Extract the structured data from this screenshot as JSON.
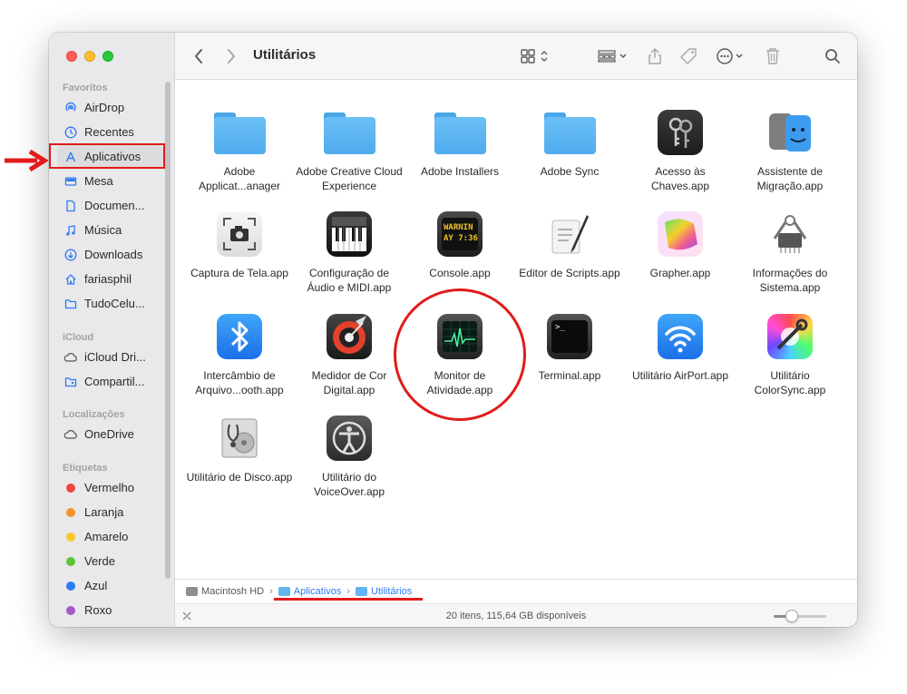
{
  "sidebar": {
    "sections": {
      "favoritos": "Favoritos",
      "icloud": "iCloud",
      "localizacoes": "Localizações",
      "etiquetas": "Etiquetas"
    },
    "favorites": [
      {
        "label": "AirDrop",
        "icon": "airdrop-icon"
      },
      {
        "label": "Recentes",
        "icon": "clock-icon"
      },
      {
        "label": "Aplicativos",
        "icon": "applications-icon"
      },
      {
        "label": "Mesa",
        "icon": "desktop-icon"
      },
      {
        "label": "Documen...",
        "icon": "document-icon"
      },
      {
        "label": "Música",
        "icon": "music-icon"
      },
      {
        "label": "Downloads",
        "icon": "download-icon"
      },
      {
        "label": "fariasphil",
        "icon": "home-icon"
      },
      {
        "label": "TudoCelu...",
        "icon": "folder-icon"
      }
    ],
    "icloud": [
      {
        "label": "iCloud Dri...",
        "icon": "cloud-icon"
      },
      {
        "label": "Compartil...",
        "icon": "shared-folder-icon"
      }
    ],
    "locations": [
      {
        "label": "OneDrive",
        "icon": "cloud-icon"
      }
    ],
    "tags": [
      {
        "label": "Vermelho",
        "color": "#f0463c"
      },
      {
        "label": "Laranja",
        "color": "#f5922e"
      },
      {
        "label": "Amarelo",
        "color": "#f5c92a"
      },
      {
        "label": "Verde",
        "color": "#5ec43a"
      },
      {
        "label": "Azul",
        "color": "#2f7bf5"
      },
      {
        "label": "Roxo",
        "color": "#a559c9"
      }
    ]
  },
  "toolbar": {
    "title": "Utilitários"
  },
  "items": [
    {
      "label": "Adobe Applicat...anager",
      "kind": "folder"
    },
    {
      "label": "Adobe Creative Cloud Experience",
      "kind": "folder"
    },
    {
      "label": "Adobe Installers",
      "kind": "folder"
    },
    {
      "label": "Adobe Sync",
      "kind": "folder"
    },
    {
      "label": "Acesso às Chaves.app",
      "kind": "keychain"
    },
    {
      "label": "Assistente de Migração.app",
      "kind": "migration"
    },
    {
      "label": "Captura de Tela.app",
      "kind": "screenshot"
    },
    {
      "label": "Configuração de Áudio e MIDI.app",
      "kind": "midi"
    },
    {
      "label": "Console.app",
      "kind": "console",
      "screen_text": "WARNIN",
      "screen_text2": "AY 7:36"
    },
    {
      "label": "Editor de Scripts.app",
      "kind": "script"
    },
    {
      "label": "Grapher.app",
      "kind": "grapher"
    },
    {
      "label": "Informações do Sistema.app",
      "kind": "sysinfo"
    },
    {
      "label": "Intercâmbio de Arquivo...ooth.app",
      "kind": "bluetooth"
    },
    {
      "label": "Medidor de Cor Digital.app",
      "kind": "colormeter"
    },
    {
      "label": "Monitor de Atividade.app",
      "kind": "activity"
    },
    {
      "label": "Terminal.app",
      "kind": "terminal",
      "screen_text": ">_"
    },
    {
      "label": "Utilitário AirPort.app",
      "kind": "airport"
    },
    {
      "label": "Utilitário ColorSync.app",
      "kind": "colorsync"
    },
    {
      "label": "Utilitário de Disco.app",
      "kind": "diskutility"
    },
    {
      "label": "Utilitário do VoiceOver.app",
      "kind": "voiceover"
    }
  ],
  "pathbar": [
    {
      "label": "Macintosh HD",
      "icon": "hard-drive-icon"
    },
    {
      "label": "Aplicativos",
      "icon": "folder-icon"
    },
    {
      "label": "Utilitários",
      "icon": "folder-icon"
    }
  ],
  "status": {
    "text": "20 itens, 115,64 GB disponíveis",
    "zoom_fraction": 0.35
  },
  "annotations": {
    "color": "#e21b1b"
  }
}
